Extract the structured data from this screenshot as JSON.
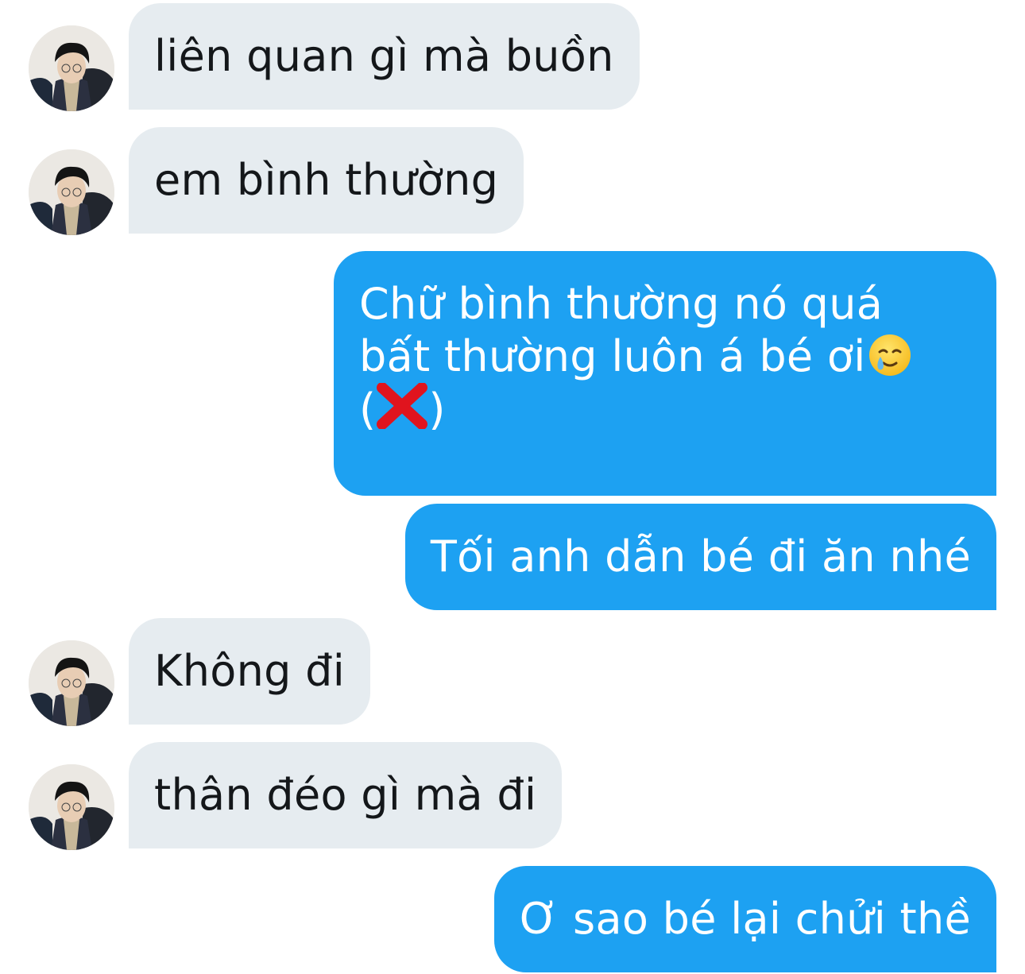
{
  "colors": {
    "incoming_bubble": "#e6ecf0",
    "outgoing_bubble": "#1da1f2",
    "incoming_text": "#14171a",
    "outgoing_text": "#ffffff"
  },
  "messages": [
    {
      "direction": "incoming",
      "text": "liên quan gì mà buồn"
    },
    {
      "direction": "incoming",
      "text": "em bình thường"
    },
    {
      "direction": "outgoing",
      "lines": [
        "Chữ bình thường nó quá",
        "bất thường luôn á bé ơi",
        "(",
        ")"
      ],
      "emojis": [
        "smiling-face-with-tear",
        "cross-mark"
      ]
    },
    {
      "direction": "outgoing",
      "text": "Tối anh dẫn bé đi ăn nhé"
    },
    {
      "direction": "incoming",
      "text": "Không đi"
    },
    {
      "direction": "incoming",
      "text": "thân đéo gì mà đi"
    },
    {
      "direction": "outgoing",
      "text": "Ơ sao bé lại chửi thề"
    }
  ]
}
